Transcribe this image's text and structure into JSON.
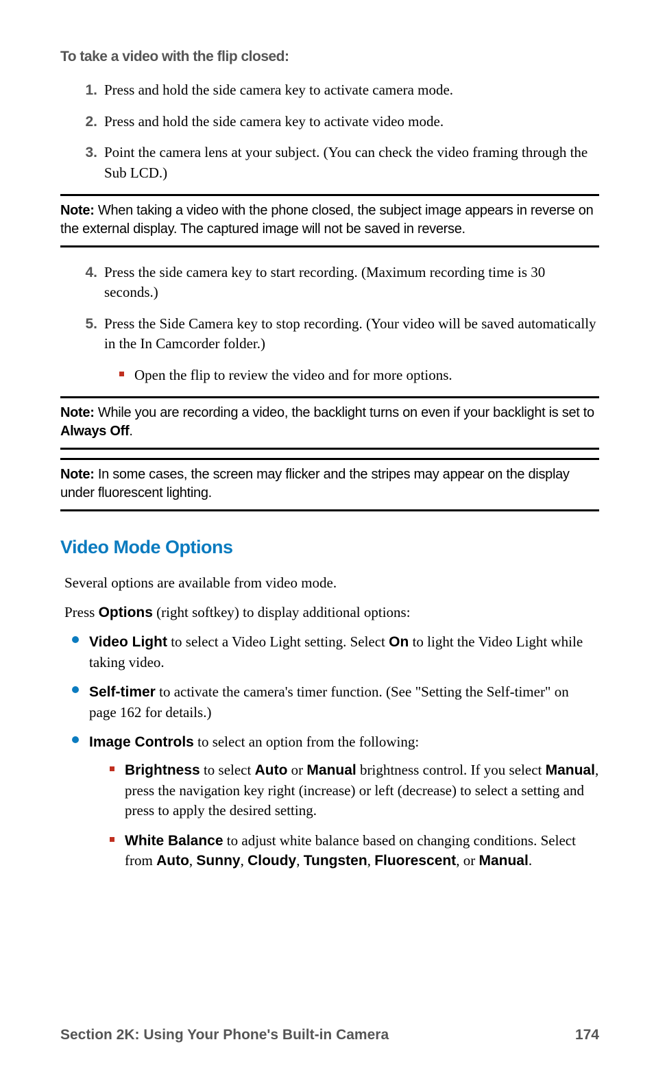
{
  "intro_heading": "To take a video with the flip closed:",
  "steps": {
    "s1": "Press and hold the side camera key to activate camera mode.",
    "s2": "Press and hold the side camera key to activate video mode.",
    "s3": "Point the camera lens at your subject. (You can check the video framing through the Sub LCD.)",
    "s4": "Press the side camera key to start recording. (Maximum recording time is 30 seconds.)",
    "s5": "Press the Side Camera key to stop recording. (Your video will be saved automatically in the In Camcorder folder.)",
    "s5_sub": "Open the flip to review the video and for more options."
  },
  "note_label": "Note:",
  "note1_rest": " When taking a video with the phone closed, the subject image appears in reverse on the external display. The captured image will not be saved in reverse.",
  "note2_a": " While you are recording a video, the backlight turns on even if your backlight is set to ",
  "note2_b": "Always Off",
  "note2_c": ".",
  "note3_rest": " In some cases, the screen may flicker and the stripes may appear on the display under fluorescent lighting.",
  "section_title": "Video Mode Options",
  "para1": "Several options are available from video mode.",
  "para2_a": "Press ",
  "para2_b": "Options",
  "para2_c": " (right softkey) to display additional options:",
  "opt1_a": "Video Light",
  "opt1_b": " to select a Video Light setting. Select ",
  "opt1_c": "On",
  "opt1_d": " to light the Video Light while taking video.",
  "opt2_a": "Self-timer",
  "opt2_b": " to activate the camera's timer function. (See \"Setting the Self-timer\" on page 162 for details.)",
  "opt3_a": "Image Controls",
  "opt3_b": " to select an option from the following:",
  "sub1_a": "Brightness",
  "sub1_b": " to select ",
  "sub1_c": "Auto",
  "sub1_d": " or ",
  "sub1_e": "Manual",
  "sub1_f": " brightness control. If you select ",
  "sub1_g": "Manual",
  "sub1_h": ", press the navigation key right (increase) or left (decrease) to select a setting and press to apply the desired setting.",
  "sub2_a": "White Balance",
  "sub2_b": " to adjust white balance based on changing conditions. Select from ",
  "sub2_list": [
    "Auto",
    "Sunny",
    "Cloudy",
    "Tungsten",
    "Fluorescent"
  ],
  "sub2_sep": ", ",
  "sub2_or": ", or ",
  "sub2_last": "Manual",
  "sub2_end": ".",
  "footer_section": "Section 2K: Using Your Phone's Built-in Camera",
  "footer_page": "174",
  "nums": {
    "n1": "1.",
    "n2": "2.",
    "n3": "3.",
    "n4": "4.",
    "n5": "5."
  }
}
